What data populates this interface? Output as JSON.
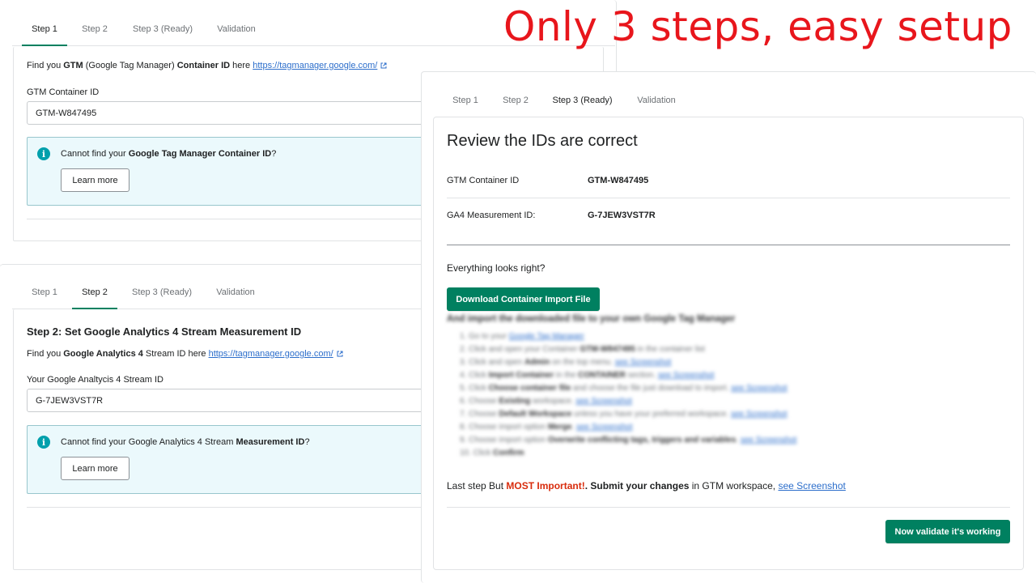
{
  "headline": "Only 3 steps, easy setup",
  "brand_color": "#008060",
  "tabs": [
    "Step 1",
    "Step 2",
    "Step 3 (Ready)",
    "Validation"
  ],
  "step1": {
    "find_prefix": "Find you ",
    "find_bold1": "GTM",
    "find_mid": " (Google Tag Manager) ",
    "find_bold2": "Container ID",
    "find_here": " here ",
    "find_link": "https://tagmanager.google.com/",
    "field_label": "GTM Container ID",
    "field_value": "GTM-W847495",
    "banner_prefix": "Cannot find your ",
    "banner_bold": "Google Tag Manager Container ID",
    "banner_suffix": "?",
    "learn_more": "Learn more"
  },
  "step2": {
    "heading_prefix": "Step 2: Set Google Analytics 4 Stream ",
    "heading_bold": "Measurement ID",
    "find_prefix": "Find you ",
    "find_bold": "Google Analytics 4",
    "find_mid": " Stream ID here ",
    "find_link": "https://tagmanager.google.com/",
    "field_label": "Your Google Analtycis 4 Stream ID",
    "field_value": "G-7JEW3VST7R",
    "banner_prefix": "Cannot find your Google Analytics 4 Stream ",
    "banner_bold": "Measurement ID",
    "banner_suffix": "?",
    "learn_more": "Learn more"
  },
  "step3": {
    "title": "Review the IDs are correct",
    "gtm_label": "GTM Container ID",
    "gtm_value": "GTM-W847495",
    "ga4_label": "GA4 Measurement ID:",
    "ga4_value": "G-7JEW3VST7R",
    "question": "Everything looks right?",
    "download_button": "Download Container Import File",
    "import_heading": "And import the downloaded file to your own Google Tag Manager",
    "steps": [
      {
        "n": "1.",
        "parts": [
          [
            "t",
            "Go to your "
          ],
          [
            "l",
            "Google Tag Manager"
          ]
        ]
      },
      {
        "n": "2.",
        "parts": [
          [
            "t",
            "Click and open your Container "
          ],
          [
            "b",
            "GTM-W847495"
          ],
          [
            "t",
            " in the container list"
          ]
        ]
      },
      {
        "n": "3.",
        "parts": [
          [
            "t",
            "Click and open "
          ],
          [
            "b",
            "Admin"
          ],
          [
            "t",
            " on the top menu. "
          ],
          [
            "l",
            "see Screenshot"
          ]
        ]
      },
      {
        "n": "4.",
        "parts": [
          [
            "t",
            "Click "
          ],
          [
            "b",
            "Import Container"
          ],
          [
            "t",
            " in the "
          ],
          [
            "b",
            "CONTAINER"
          ],
          [
            "t",
            " section. "
          ],
          [
            "l",
            "see Screenshot"
          ]
        ]
      },
      {
        "n": "5.",
        "parts": [
          [
            "t",
            "Click "
          ],
          [
            "b",
            "Choose container file"
          ],
          [
            "t",
            " and choose the file just download to import. "
          ],
          [
            "l",
            "see Screenshot"
          ]
        ]
      },
      {
        "n": "6.",
        "parts": [
          [
            "t",
            "Choose "
          ],
          [
            "b",
            "Existing"
          ],
          [
            "t",
            " workspace. "
          ],
          [
            "l",
            "see Screenshot"
          ]
        ]
      },
      {
        "n": "7.",
        "parts": [
          [
            "t",
            "Choose "
          ],
          [
            "b",
            "Default Workspace"
          ],
          [
            "t",
            " unless you have your preferred workspace. "
          ],
          [
            "l",
            "see Screenshot"
          ]
        ]
      },
      {
        "n": "8.",
        "parts": [
          [
            "t",
            "Choose import option "
          ],
          [
            "b",
            "Merge"
          ],
          [
            "t",
            ". "
          ],
          [
            "l",
            "see Screenshot"
          ]
        ]
      },
      {
        "n": "9.",
        "parts": [
          [
            "t",
            "Choose import option "
          ],
          [
            "b",
            "Overwrite conflicting tags, triggers and variables"
          ],
          [
            "t",
            ". "
          ],
          [
            "l",
            "see Screenshot"
          ]
        ]
      },
      {
        "n": "10.",
        "parts": [
          [
            "t",
            "Click "
          ],
          [
            "b",
            "Confirm"
          ]
        ]
      }
    ],
    "last_prefix": "Last step But ",
    "last_important": "MOST Important!",
    "last_dot": ". ",
    "last_bold": "Submit your changes",
    "last_mid": " in GTM workspace, ",
    "last_link": "see Screenshot",
    "validate_button": "Now validate it's working"
  }
}
